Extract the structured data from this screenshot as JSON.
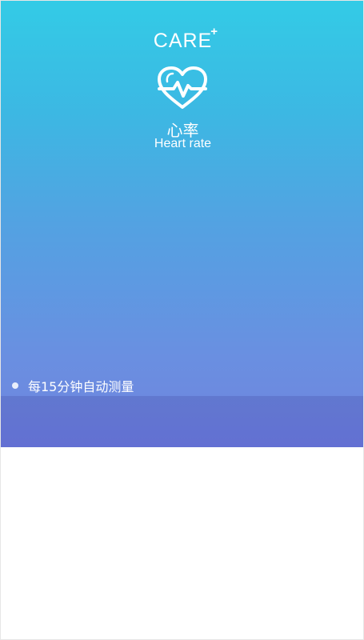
{
  "app": {
    "logo_text": "CARE",
    "logo_mark": "+"
  },
  "header": {
    "icon": "heart-pulse-icon",
    "title_cn": "心率",
    "title_en": "Heart rate"
  },
  "info": {
    "bullet_text": "每15分钟自动测量"
  },
  "colors": {
    "gradient_top": "#33cbe6",
    "gradient_bottom": "#6f84de",
    "band": "#6370d3",
    "text": "#ffffff"
  }
}
